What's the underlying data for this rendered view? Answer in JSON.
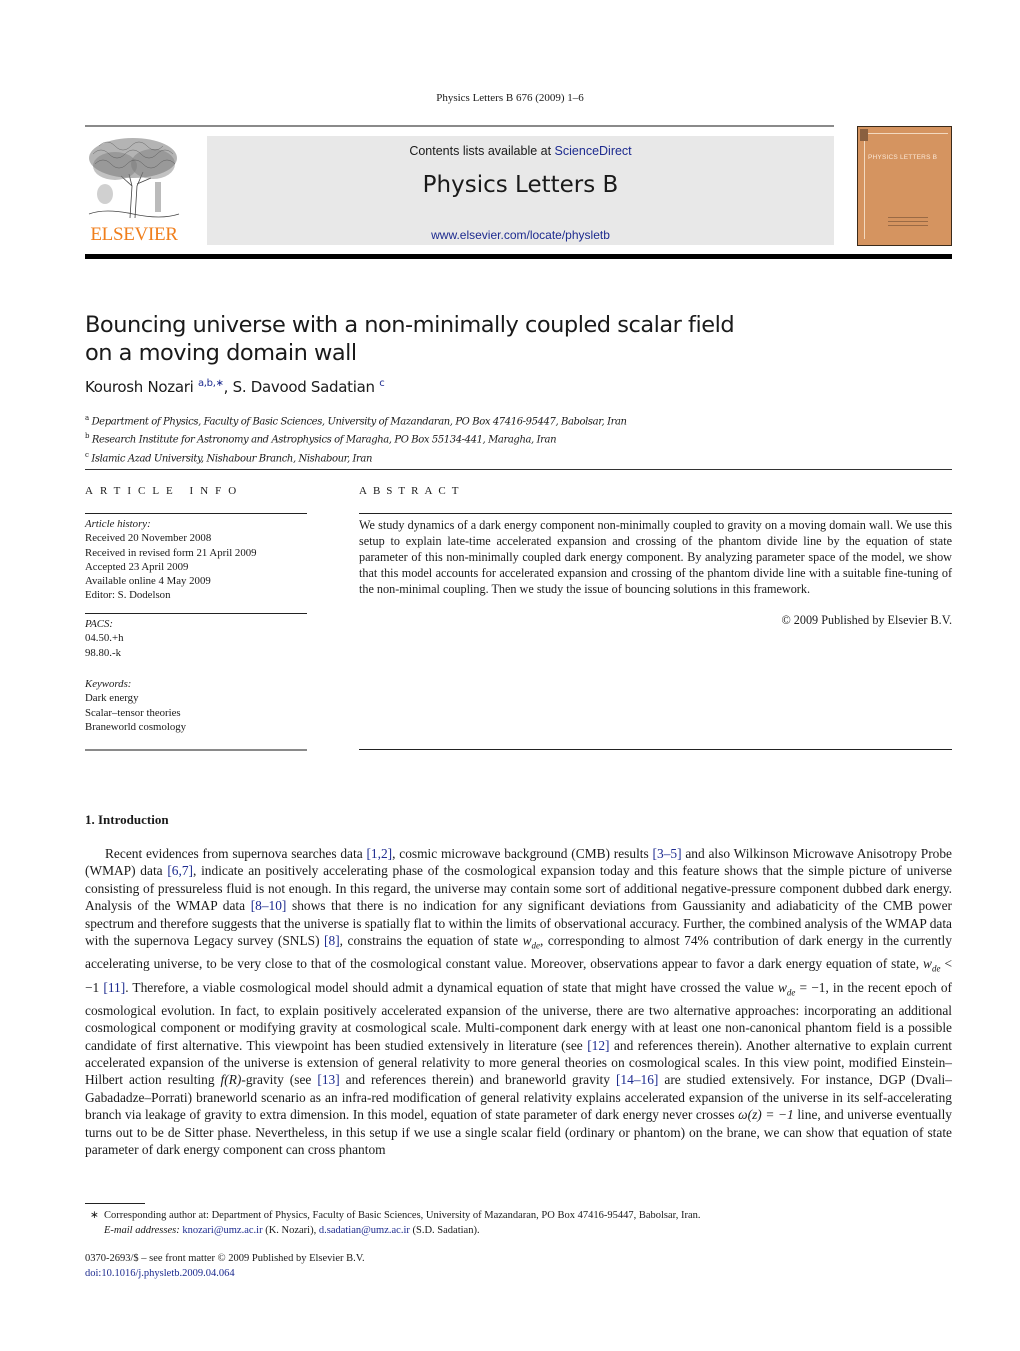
{
  "running_head": "Physics Letters B 676 (2009) 1–6",
  "masthead": {
    "publisher_logo_text": "ELSEVIER",
    "contents_prefix": "Contents lists available at ",
    "contents_link": "ScienceDirect",
    "journal_title": "Physics Letters B",
    "journal_url": "www.elsevier.com/locate/physletb",
    "cover_title": "PHYSICS LETTERS B",
    "colors": {
      "publisher_orange": "#f07e1b",
      "cover": "#d59460",
      "masthead_bg": "#e8e8e8",
      "link": "#1d2b8f"
    }
  },
  "article": {
    "title_line1": "Bouncing universe with a non-minimally coupled scalar field",
    "title_line2": "on a moving domain wall",
    "authors": [
      {
        "name": "Kourosh Nozari",
        "marks": "a,b,∗"
      },
      {
        "name": "S. Davood Sadatian",
        "marks": "c"
      }
    ],
    "author_separator": ", ",
    "affiliations": [
      {
        "mark": "a",
        "text": "Department of Physics, Faculty of Basic Sciences, University of Mazandaran, PO Box 47416-95447, Babolsar, Iran"
      },
      {
        "mark": "b",
        "text": "Research Institute for Astronomy and Astrophysics of Maragha, PO Box 55134-441, Maragha, Iran"
      },
      {
        "mark": "c",
        "text": "Islamic Azad University, Nishabour Branch, Nishabour, Iran"
      }
    ]
  },
  "article_info": {
    "heading": "ARTICLE INFO",
    "history_label": "Article history:",
    "history": [
      "Received 20 November 2008",
      "Received in revised form 21 April 2009",
      "Accepted 23 April 2009",
      "Available online 4 May 2009",
      "Editor: S. Dodelson"
    ],
    "pacs_label": "PACS:",
    "pacs": [
      "04.50.+h",
      "98.80.-k"
    ],
    "keywords_label": "Keywords:",
    "keywords": [
      "Dark energy",
      "Scalar–tensor theories",
      "Braneworld cosmology"
    ]
  },
  "abstract": {
    "heading": "ABSTRACT",
    "text": "We study dynamics of a dark energy component non-minimally coupled to gravity on a moving domain wall. We use this setup to explain late-time accelerated expansion and crossing of the phantom divide line by the equation of state parameter of this non-minimally coupled dark energy component. By analyzing parameter space of the model, we show that this model accounts for accelerated expansion and crossing of the phantom divide line with a suitable fine-tuning of the non-minimal coupling. Then we study the issue of bouncing solutions in this framework.",
    "copyright": "© 2009 Published by Elsevier B.V."
  },
  "introduction": {
    "heading": "1. Introduction",
    "segments": [
      {
        "t": "Recent evidences from supernova searches data "
      },
      {
        "ref": "[1,2]"
      },
      {
        "t": ", cosmic microwave background (CMB) results "
      },
      {
        "ref": "[3–5]"
      },
      {
        "t": " and also Wilkinson Microwave Anisotropy Probe (WMAP) data "
      },
      {
        "ref": "[6,7]"
      },
      {
        "t": ", indicate an positively accelerating phase of the cosmological expansion today and this feature shows that the simple picture of universe consisting of pressureless fluid is not enough. In this regard, the universe may contain some sort of additional negative-pressure component dubbed dark energy. Analysis of the WMAP data "
      },
      {
        "ref": "[8–10]"
      },
      {
        "t": " shows that there is no indication for any significant deviations from Gaussianity and adiabaticity of the CMB power spectrum and therefore suggests that the universe is spatially flat to within the limits of observational accuracy. Further, the combined analysis of the WMAP data with the supernova Legacy survey (SNLS) "
      },
      {
        "ref": "[8]"
      },
      {
        "t": ", constrains the equation of state "
      },
      {
        "math": "w_de"
      },
      {
        "t": ", corresponding to almost 74% contribution of dark energy in the currently accelerating universe, to be very close to that of the cosmological constant value. Moreover, observations appear to favor a dark energy equation of state, "
      },
      {
        "math": "w_de < −1"
      },
      {
        "t": " "
      },
      {
        "ref": "[11]"
      },
      {
        "t": ". Therefore, a viable cosmological model should admit a dynamical equation of state that might have crossed the value "
      },
      {
        "math": "w_de = −1"
      },
      {
        "t": ", in the recent epoch of cosmological evolution. In fact, to explain positively accelerated expansion of the universe, there are two alternative approaches: incorporating an additional cosmological component or modifying gravity at cosmological scale. Multi-component dark energy with at least one non-canonical phantom field is a possible candidate of first alternative. This viewpoint has been studied extensively in literature (see "
      },
      {
        "ref": "[12]"
      },
      {
        "t": " and references therein). Another alternative to explain current accelerated expansion of the universe is extension of general relativity to more general theories on cosmological scales. In this view point, modified Einstein–Hilbert action resulting "
      },
      {
        "math": "f(R)"
      },
      {
        "t": "-gravity (see "
      },
      {
        "ref": "[13]"
      },
      {
        "t": " and references therein) and braneworld gravity "
      },
      {
        "ref": "[14–16]"
      },
      {
        "t": " are studied extensively. For instance, DGP (Dvali–Gabadadze–Porrati) braneworld scenario as an infra-red modification of general relativity explains accelerated expansion of the universe in its self-accelerating branch via leakage of gravity to extra dimension. In this model, equation of state parameter of dark energy never crosses "
      },
      {
        "math": "ω(z) = −1"
      },
      {
        "t": " line, and universe eventually turns out to be de Sitter phase. Nevertheless, in this setup if we use a single scalar field (ordinary or phantom) on the brane, we can show that equation of state parameter of dark energy component can cross phantom"
      }
    ]
  },
  "footnote": {
    "mark": "∗",
    "corresponding": "Corresponding author at: Department of Physics, Faculty of Basic Sciences, University of Mazandaran, PO Box 47416-95447, Babolsar, Iran.",
    "email_label": "E-mail addresses:",
    "emails": [
      {
        "address": "knozari@umz.ac.ir",
        "who": " (K. Nozari)"
      },
      {
        "address": "d.sadatian@umz.ac.ir",
        "who": " (S.D. Sadatian)."
      }
    ],
    "email_sep": ", "
  },
  "front_matter": {
    "issn_line": "0370-2693/$ – see front matter  © 2009 Published by Elsevier B.V.",
    "doi": "doi:10.1016/j.physletb.2009.04.064"
  }
}
